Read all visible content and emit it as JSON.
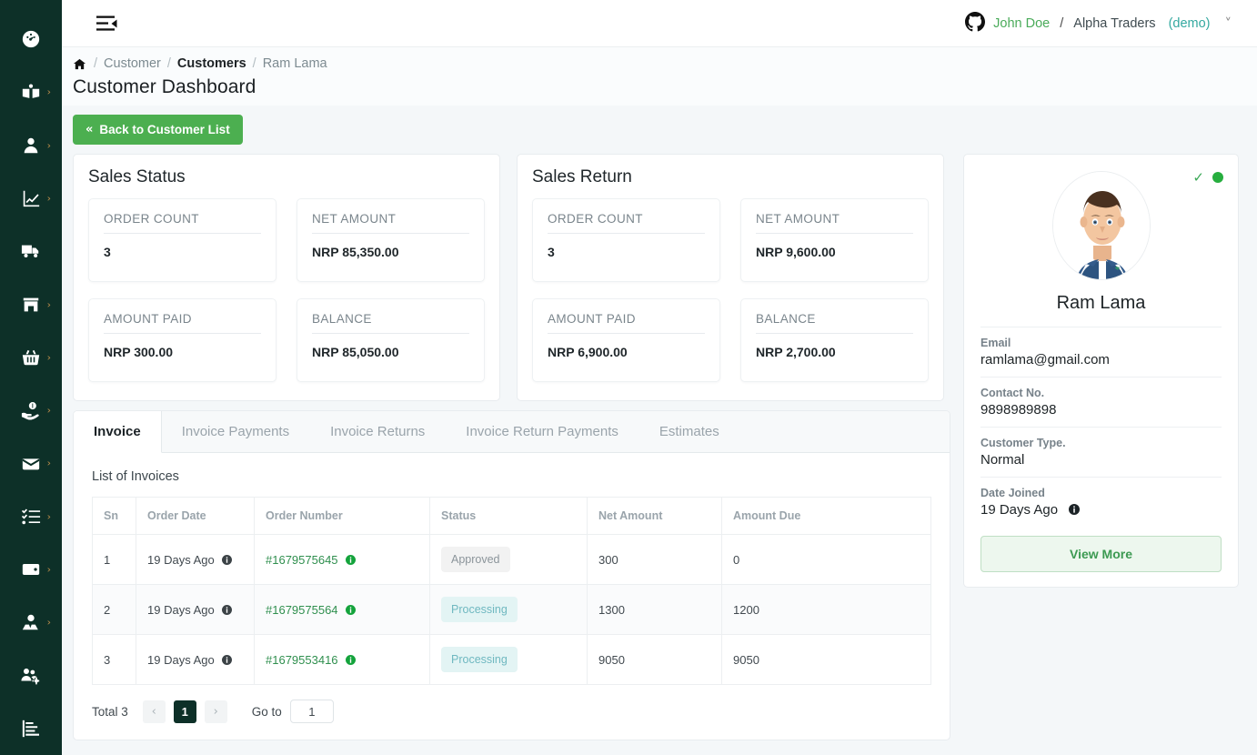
{
  "topbar": {
    "collapse_icon": "menu-collapse-icon",
    "user": {
      "avatar_icon": "github-icon",
      "name": "John Doe",
      "separator": "/",
      "org": "Alpha Traders",
      "env": "(demo)",
      "caret": "⌄"
    }
  },
  "sidebar": {
    "items": [
      {
        "icon": "dashboard-icon",
        "has_caret": false
      },
      {
        "icon": "book-user-icon",
        "has_caret": true
      },
      {
        "icon": "user-icon",
        "has_caret": true
      },
      {
        "icon": "chart-line-icon",
        "has_caret": true
      },
      {
        "icon": "truck-icon",
        "has_caret": false
      },
      {
        "icon": "store-icon",
        "has_caret": true
      },
      {
        "icon": "basket-icon",
        "has_caret": true
      },
      {
        "icon": "hand-money-icon",
        "has_caret": true
      },
      {
        "icon": "inbox-icon",
        "has_caret": true
      },
      {
        "icon": "checklist-icon",
        "has_caret": true
      },
      {
        "icon": "wallet-icon",
        "has_caret": true
      },
      {
        "icon": "users-podium-icon",
        "has_caret": true
      },
      {
        "icon": "users-gear-icon",
        "has_caret": false
      },
      {
        "icon": "report-bar-icon",
        "has_caret": false
      }
    ]
  },
  "breadcrumb": {
    "home_icon": "home-icon",
    "items": [
      "Customer",
      "Customers",
      "Ram Lama"
    ],
    "active_index": 1,
    "separator": "/"
  },
  "page_title": "Customer Dashboard",
  "back_button": {
    "chevron": "«",
    "label": "Back to Customer List"
  },
  "sales_status": {
    "title": "Sales Status",
    "metrics": [
      {
        "label": "ORDER COUNT",
        "value": "3"
      },
      {
        "label": "NET AMOUNT",
        "value": "NRP 85,350.00"
      },
      {
        "label": "AMOUNT PAID",
        "value": "NRP 300.00"
      },
      {
        "label": "BALANCE",
        "value": "NRP 85,050.00"
      }
    ]
  },
  "sales_return": {
    "title": "Sales Return",
    "metrics": [
      {
        "label": "ORDER COUNT",
        "value": "3"
      },
      {
        "label": "NET AMOUNT",
        "value": "NRP 9,600.00"
      },
      {
        "label": "AMOUNT PAID",
        "value": "NRP 6,900.00"
      },
      {
        "label": "BALANCE",
        "value": "NRP 2,700.00"
      }
    ]
  },
  "tabs": [
    {
      "label": "Invoice",
      "active": true
    },
    {
      "label": "Invoice Payments",
      "active": false
    },
    {
      "label": "Invoice Returns",
      "active": false
    },
    {
      "label": "Invoice Return Payments",
      "active": false
    },
    {
      "label": "Estimates",
      "active": false
    }
  ],
  "invoice_table": {
    "caption": "List of Invoices",
    "columns": [
      "Sn",
      "Order Date",
      "Order Number",
      "Status",
      "Net Amount",
      "Amount Due"
    ],
    "rows": [
      {
        "sn": "1",
        "order_date": "19 Days Ago",
        "order_number": "#1679575645",
        "status": "Approved",
        "status_kind": "approved",
        "net_amount": "300",
        "amount_due": "0"
      },
      {
        "sn": "2",
        "order_date": "19 Days Ago",
        "order_number": "#1679575564",
        "status": "Processing",
        "status_kind": "processing",
        "net_amount": "1300",
        "amount_due": "1200"
      },
      {
        "sn": "3",
        "order_date": "19 Days Ago",
        "order_number": "#1679553416",
        "status": "Processing",
        "status_kind": "processing",
        "net_amount": "9050",
        "amount_due": "9050"
      }
    ]
  },
  "pagination": {
    "total_label": "Total 3",
    "prev": "‹",
    "next": "›",
    "current_page": "1",
    "goto_label": "Go to",
    "goto_value": "1"
  },
  "profile": {
    "status_check": "✓",
    "status_dot_color": "#27ae3f",
    "avatar_icon": "user-avatar-illustration",
    "name": "Ram Lama",
    "fields": [
      {
        "label": "Email",
        "value": "ramlama@gmail.com",
        "info": false
      },
      {
        "label": "Contact No.",
        "value": "9898989898",
        "info": false
      },
      {
        "label": "Customer Type.",
        "value": "Normal",
        "info": false
      },
      {
        "label": "Date Joined",
        "value": "19 Days Ago",
        "info": true
      }
    ],
    "view_more_label": "View More"
  },
  "colors": {
    "sidebar": "#0d3028",
    "accent_green": "#4caf50",
    "link_green": "#2f8f4e",
    "page_bg": "#f4f7f9",
    "badge_processing_bg": "#e3f4f4",
    "badge_processing_fg": "#6fb8c0",
    "badge_approved_bg": "#f2f2f2",
    "badge_approved_fg": "#8b949a"
  }
}
